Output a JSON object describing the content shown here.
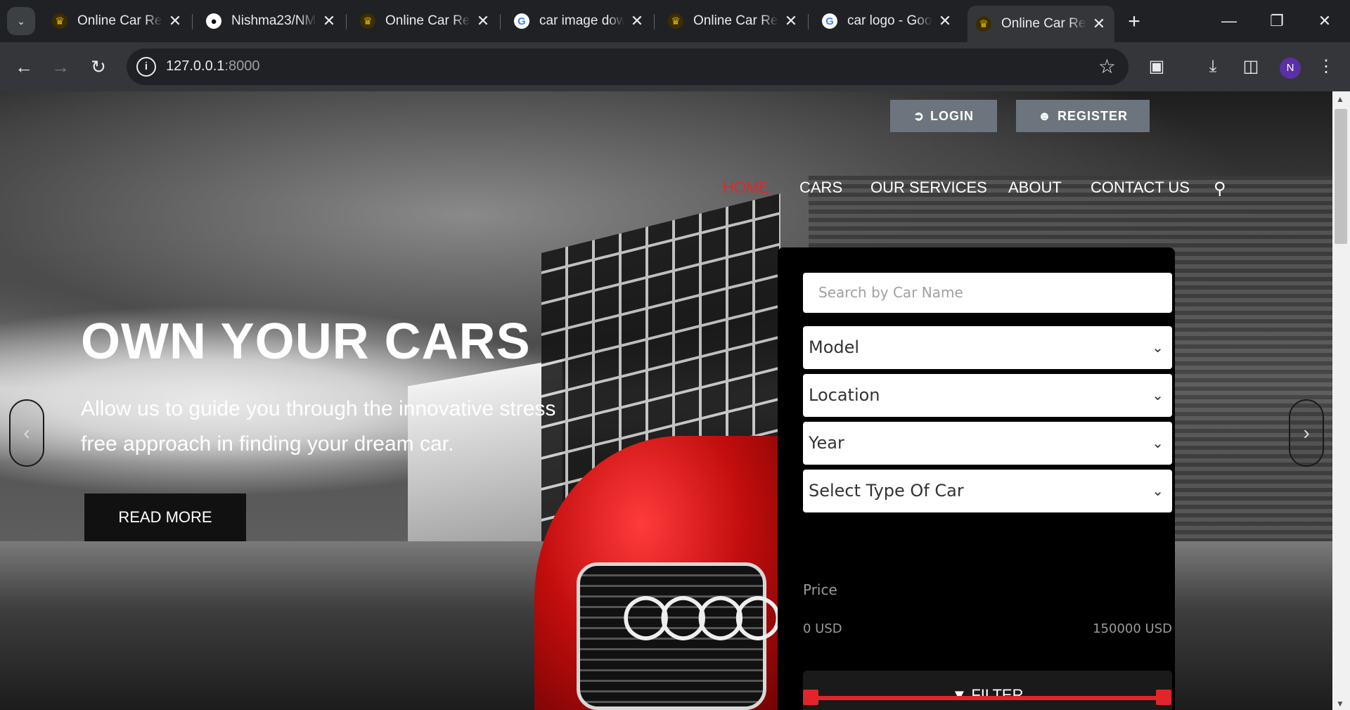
{
  "browser": {
    "tabs": [
      {
        "title": "Online Car Rental",
        "favicon": "site-logo-icon"
      },
      {
        "title": "Nishma23/NM",
        "favicon": "github-icon"
      },
      {
        "title": "Online Car Rental",
        "favicon": "site-logo-icon"
      },
      {
        "title": "car image download",
        "favicon": "google-icon"
      },
      {
        "title": "Online Car Rental",
        "favicon": "site-logo-icon"
      },
      {
        "title": "car logo - Google",
        "favicon": "google-icon"
      },
      {
        "title": "Online Car Rental",
        "favicon": "site-logo-icon"
      }
    ],
    "url_host": "127.0.0.1",
    "url_port": ":8000",
    "profile_initial": "N"
  },
  "header": {
    "login_label": "LOGIN",
    "register_label": "REGISTER",
    "nav": [
      "HOME",
      "CARS",
      "OUR SERVICES",
      "ABOUT",
      "CONTACT US"
    ],
    "active_nav": "HOME",
    "accent_color": "#e0262b"
  },
  "hero": {
    "headline": "OWN YOUR CARS",
    "subtitle": "Allow us to guide you through the innovative stress free approach in finding your dream car.",
    "cta_label": "READ MORE"
  },
  "search_panel": {
    "search_placeholder": "Search by Car Name",
    "model_label": "Model",
    "location_label": "Location",
    "year_label": "Year",
    "type_label": "Select Type Of Car",
    "price_label": "Price",
    "price_min": "0 USD",
    "price_max": "150000 USD",
    "filter_label": "FILTER"
  }
}
